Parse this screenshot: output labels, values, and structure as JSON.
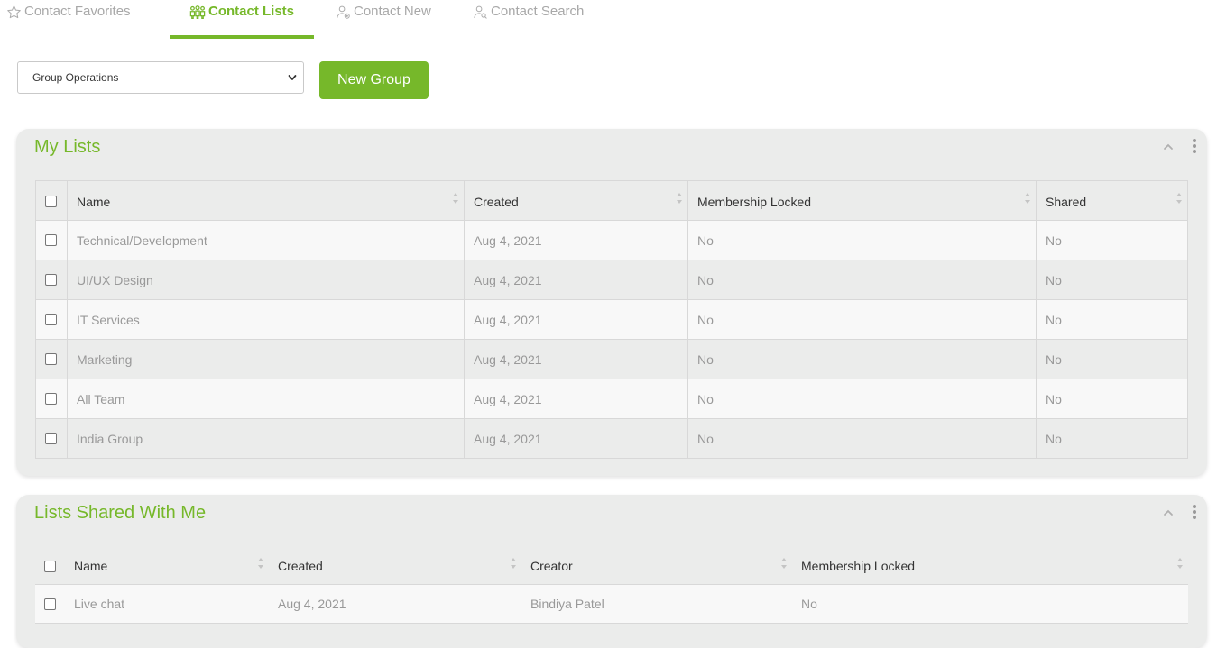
{
  "tabs": [
    {
      "label": "Contact Favorites",
      "icon": "star-icon",
      "active": false
    },
    {
      "label": "Contact Lists",
      "icon": "group-icon",
      "active": true
    },
    {
      "label": "Contact New",
      "icon": "user-add-icon",
      "active": false
    },
    {
      "label": "Contact Search",
      "icon": "user-search-icon",
      "active": false
    }
  ],
  "toolbar": {
    "group_operations_value": "Group Operations",
    "new_group_label": "New Group"
  },
  "colors": {
    "accent": "#76b82a",
    "panel_bg": "#ebeceb",
    "muted_text": "#999999"
  },
  "my_lists": {
    "title": "My Lists",
    "columns": [
      "Name",
      "Created",
      "Membership Locked",
      "Shared"
    ],
    "rows": [
      {
        "name": "Technical/Development",
        "created": "Aug 4, 2021",
        "locked": "No",
        "shared": "No"
      },
      {
        "name": "UI/UX Design",
        "created": "Aug 4, 2021",
        "locked": "No",
        "shared": "No"
      },
      {
        "name": "IT Services",
        "created": "Aug 4, 2021",
        "locked": "No",
        "shared": "No"
      },
      {
        "name": "Marketing",
        "created": "Aug 4, 2021",
        "locked": "No",
        "shared": "No"
      },
      {
        "name": "All Team",
        "created": "Aug 4, 2021",
        "locked": "No",
        "shared": "No"
      },
      {
        "name": "India Group",
        "created": "Aug 4, 2021",
        "locked": "No",
        "shared": "No"
      }
    ]
  },
  "shared_lists": {
    "title": "Lists Shared With Me",
    "columns": [
      "Name",
      "Created",
      "Creator",
      "Membership Locked"
    ],
    "rows": [
      {
        "name": "Live chat",
        "created": "Aug 4, 2021",
        "creator": "Bindiya Patel",
        "locked": "No"
      }
    ]
  }
}
